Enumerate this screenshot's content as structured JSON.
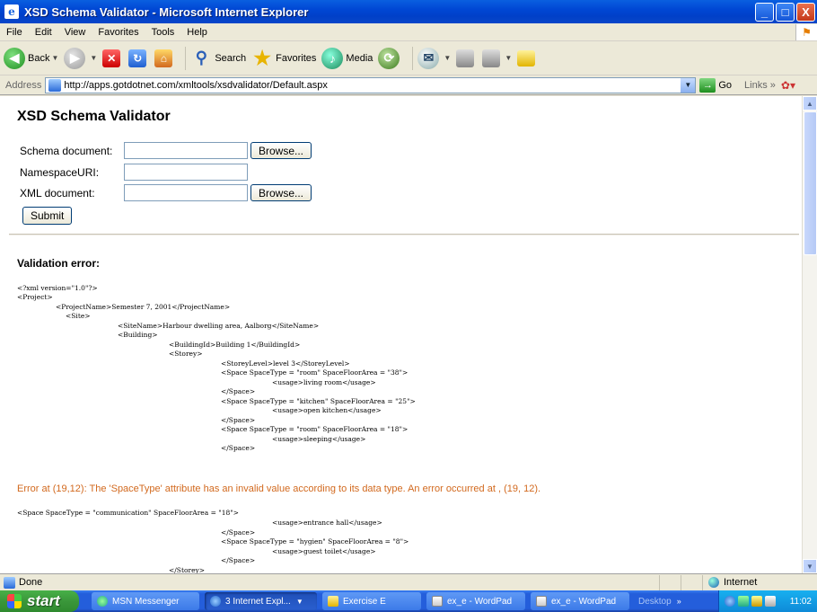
{
  "window": {
    "title": "XSD Schema Validator - Microsoft Internet Explorer",
    "minimize": "_",
    "maximize": "□",
    "close": "X"
  },
  "menu": [
    "File",
    "Edit",
    "View",
    "Favorites",
    "Tools",
    "Help"
  ],
  "toolbar": {
    "back": "Back",
    "search": "Search",
    "favorites": "Favorites",
    "media": "Media"
  },
  "address": {
    "label": "Address",
    "url": "http://apps.gotdotnet.com/xmltools/xsdvalidator/Default.aspx",
    "go": "Go",
    "links": "Links"
  },
  "page": {
    "title": "XSD Schema Validator",
    "schema_label": "Schema document:",
    "namespace_label": "NamespaceURI:",
    "xml_label": "XML document:",
    "browse": "Browse...",
    "submit": "Submit",
    "error_heading": "Validation error:",
    "xml_lines_1": [
      "<?xml version=\"1.0\"?>",
      "<Project>",
      "<ProjectName>Semester 7, 2001</ProjectName>",
      "<Site>",
      "<SiteName>Harbour dwelling area, Aalborg</SiteName>",
      "<Building>",
      "<BuildingId>Building 1</BuildingId>",
      "<Storey>",
      "<StoreyLevel>level 3</StoreyLevel>",
      "<Space SpaceType = \"room\" SpaceFloorArea = \"38\">",
      "<usage>living room</usage>",
      "</Space>",
      "<Space SpaceType = \"kitchen\" SpaceFloorArea = \"25\">",
      "<usage>open kitchen</usage>",
      "</Space>",
      "<Space SpaceType = \"room\" SpaceFloorArea = \"18\">",
      "<usage>sleeping</usage>",
      "</Space>"
    ],
    "error_message": "Error at (19,12): The 'SpaceType' attribute has an invalid value according to its data type. An error occurred at , (19, 12).",
    "xml_lines_2": [
      "<Space SpaceType = \"communication\" SpaceFloorArea = \"18\">",
      "<usage>entrance hall</usage>",
      "</Space>",
      "<Space SpaceType = \"hygien\" SpaceFloorArea = \"8\">",
      "<usage>guest toilet</usage>",
      "</Space>",
      "</Storey>"
    ]
  },
  "status": {
    "text": "Done",
    "zone": "Internet"
  },
  "taskbar": {
    "start": "start",
    "tasks": [
      "MSN Messenger",
      "3 Internet Expl...",
      "Exercise E",
      "ex_e - WordPad",
      "ex_e - WordPad"
    ],
    "desktop": "Desktop",
    "clock": "11:02"
  }
}
